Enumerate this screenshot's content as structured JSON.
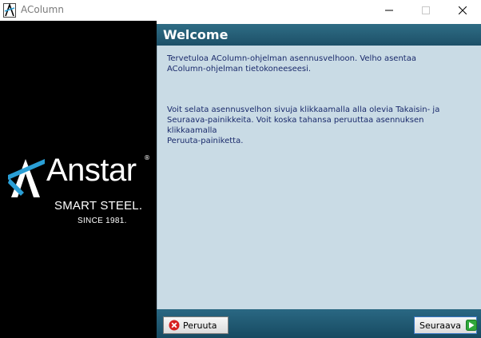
{
  "window": {
    "title": "AColumn"
  },
  "sidebar": {
    "logo_word": "Anstar",
    "logo_registered": "®",
    "logo_tagline": "SMART STEEL.",
    "logo_since": "SINCE 1981."
  },
  "header": {
    "title": "Welcome"
  },
  "content": {
    "paragraph1": "Tervetuloa AColumn-ohjelman asennusvelhoon. Velho asentaa\nAColumn-ohjelman tietokoneeseesi.",
    "paragraph2": "Voit selata asennusvelhon sivuja klikkaamalla alla olevia Takaisin- ja\nSeuraava-painikkeita. Voit koska tahansa peruuttaa asennuksen klikkaamalla\nPeruuta-painiketta."
  },
  "footer": {
    "cancel_label": "Peruuta",
    "next_label": "Seuraava"
  },
  "colors": {
    "header_bg": "#2f6d85",
    "content_bg": "#c9dbe5",
    "text": "#1a2a6b",
    "logo_accent": "#2a9fd6"
  },
  "icons": {
    "app": "app-icon",
    "cancel": "cancel-icon",
    "next": "next-arrow-icon"
  }
}
